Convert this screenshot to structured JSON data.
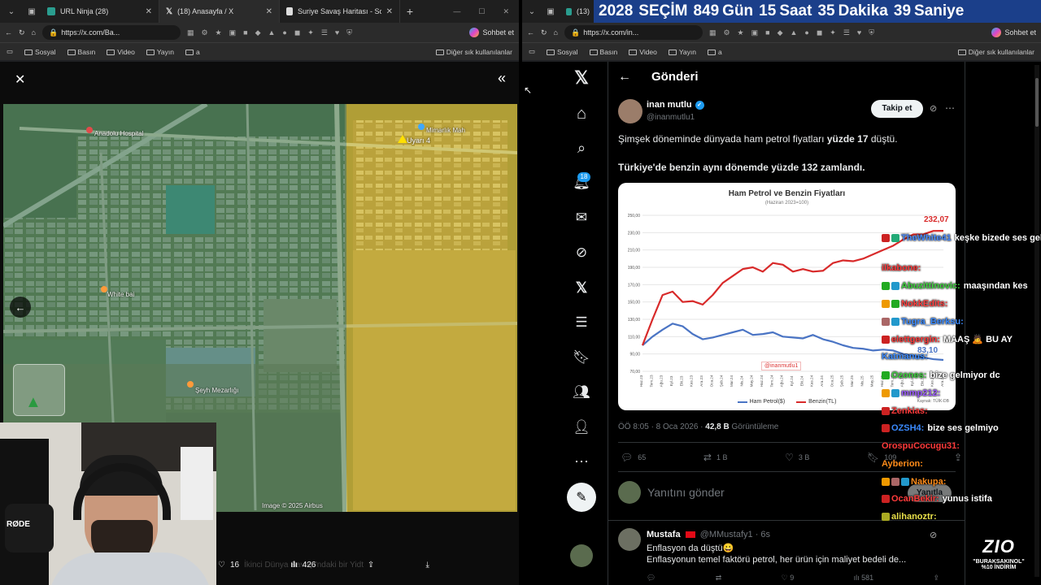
{
  "left_window": {
    "tabs": [
      {
        "label": "URL Ninja (28)"
      },
      {
        "label": "(18) Anasayfa / X"
      },
      {
        "label": "Suriye Savaş Haritası - Son Dak"
      }
    ],
    "url": "https://x.com/Ba...",
    "copilot_label": "Sohbet et",
    "bookmarks": [
      "Sosyal",
      "Basın",
      "Video",
      "Yayın",
      "a"
    ],
    "bookmarks_other": "Diğer sık kullanılanlar",
    "map_labels": {
      "anadolu": "Anadolu Hospital",
      "uyari": "Uyarı 4",
      "mimar": "Mimarlık Mah",
      "white": "White bai",
      "cemetery": "Şeyh Mezarlığı",
      "attribution": "Image © 2025 Airbus"
    },
    "media_stats": {
      "likes": "16",
      "views": "426"
    },
    "faded_text": "İkinci Dünya Savaşı'ndaki bir Yidt"
  },
  "right_window": {
    "tab_label": "(13)",
    "banner": {
      "year": "2028",
      "word": "SEÇİM",
      "days": "849",
      "days_label": "Gün",
      "hours": "15",
      "hours_label": "Saat",
      "minutes": "35",
      "minutes_label": "Dakika",
      "seconds": "39",
      "seconds_label": "Saniye"
    },
    "url": "https://x.com/in...",
    "copilot_label": "Sohbet et",
    "bookmarks": [
      "Sosyal",
      "Basın",
      "Video",
      "Yayın",
      "a"
    ],
    "bookmarks_other": "Diğer sık kullanılanlar",
    "nav_badge": "18",
    "post": {
      "header": "Gönderi",
      "author_name": "inan mutlu",
      "author_handle": "@inanmutlu1",
      "follow_label": "Takip et",
      "text1_pre": "Şimşek döneminde dünyada ham petrol fiyatları ",
      "text1_bold": "yüzde 17",
      "text1_post": " düştü.",
      "text2": "Türkiye'de benzin aynı dönemde yüzde 132 zamlandı.",
      "time": "ÖÖ 8:05 · 8 Oca 2026 · ",
      "views": "42,8 B",
      "views_label": " Görüntüleme",
      "replies": "65",
      "reposts": "1 B",
      "likes": "3 B",
      "bookmarks": "109",
      "reply_placeholder": "Yanıtını gönder",
      "reply_button": "Yanıtla"
    },
    "reply": {
      "name": "Mustafa",
      "handle": "@MMustafy1 · 6s",
      "line1": "Enflasyon da düştü😀",
      "line2": "Enflasyonun temel faktörü petrol, her ürün için maliyet bedeli de...",
      "views": "581",
      "likes": "9"
    }
  },
  "chart_data": {
    "type": "line",
    "title": "Ham Petrol ve Benzin Fiyatları",
    "subtitle": "(Haziran 2023=100)",
    "watermark": "@inanmutlu1",
    "source": "Kaynak: TÜİK-DB",
    "categories": [
      "Haz.23",
      "Tem.23",
      "Ağu.23",
      "Eyl.23",
      "Eki.23",
      "Kas.23",
      "Ara.23",
      "Oca.24",
      "Şub.24",
      "Mar.24",
      "Nis.24",
      "May.24",
      "Haz.24",
      "Tem.24",
      "Ağu.24",
      "Eyl.24",
      "Eki.24",
      "Kas.24",
      "Ara.24",
      "Oca.25",
      "Şub.25",
      "Mar.25",
      "Nis.25",
      "May.25",
      "Haz.25",
      "Tem.25",
      "Ağu.25",
      "Eyl.25",
      "Eki.25",
      "Kas.25",
      "Ara.25"
    ],
    "ylim": [
      70,
      250
    ],
    "yticks": [
      "250,00",
      "230,00",
      "210,00",
      "190,00",
      "170,00",
      "150,00",
      "130,00",
      "110,00",
      "90,00",
      "70,00"
    ],
    "series": [
      {
        "name": "Ham Petrol($)",
        "color": "#4a74c4",
        "values": [
          100,
          110,
          118,
          125,
          122,
          113,
          107,
          109,
          112,
          115,
          118,
          112,
          113,
          115,
          110,
          109,
          108,
          112,
          107,
          104,
          100,
          97,
          96,
          94,
          95,
          94,
          90,
          88,
          86,
          84,
          83.1
        ]
      },
      {
        "name": "Benzin(TL)",
        "color": "#d82a2a",
        "values": [
          100,
          130,
          158,
          162,
          150,
          151,
          147,
          158,
          172,
          180,
          188,
          190,
          185,
          195,
          193,
          185,
          188,
          185,
          186,
          195,
          198,
          197,
          200,
          205,
          210,
          215,
          222,
          228,
          228,
          232,
          232.07
        ]
      }
    ],
    "end_labels": {
      "top": "232,07",
      "bottom": "83,10"
    }
  },
  "chat": [
    {
      "user": "TheWhite41",
      "color": "#4b8bff",
      "msg": "keşke bizede ses gelse",
      "badges": [
        "#c22",
        "#2a7"
      ]
    },
    {
      "user": "ilkabone:",
      "color": "#ff3b3b",
      "msg": "",
      "badges": []
    },
    {
      "user": "Abuzittinovic:",
      "color": "#3fd13f",
      "msg": "maaşından kes",
      "badges": [
        "#2a2",
        "#29c"
      ]
    },
    {
      "user": "NokkEdits:",
      "color": "#ff4040",
      "msg": "",
      "badges": [
        "#e90",
        "#2a2"
      ]
    },
    {
      "user": "Tugra_Berksu:",
      "color": "#3b8bff",
      "msg": "",
      "badges": [
        "#a66",
        "#29c"
      ]
    },
    {
      "user": "elettgergin:",
      "color": "#ff3b3b",
      "msg": "MAAŞ 🙇 BU AY",
      "badges": [
        "#c22"
      ]
    },
    {
      "user": "Katmanus:",
      "color": "#3b8bff",
      "msg": "",
      "badges": []
    },
    {
      "user": "Ozones:",
      "color": "#3fd13f",
      "msg": "bize gelmiyor dc",
      "badges": [
        "#2a2"
      ]
    },
    {
      "user": "mmp212:",
      "color": "#9b59ff",
      "msg": "",
      "badges": [
        "#e90",
        "#29c"
      ]
    },
    {
      "user": "Zenkias:",
      "color": "#ff3b3b",
      "msg": "",
      "badges": [
        "#c22"
      ]
    },
    {
      "user": "OZSH4:",
      "color": "#3b8bff",
      "msg": "bize ses gelmiyo",
      "badges": [
        "#c22"
      ]
    },
    {
      "user": "OrospuCocugu31:",
      "color": "#ff3b3b",
      "msg": "",
      "badges": []
    },
    {
      "user": "Ayberion:",
      "color": "#ff8c1a",
      "msg": "",
      "badges": []
    },
    {
      "user": "Nakupa:",
      "color": "#ff8c1a",
      "msg": "",
      "badges": [
        "#e90",
        "#a66",
        "#29c"
      ]
    },
    {
      "user": "OcanBekir:",
      "color": "#ff3b3b",
      "msg": "yunus istifa",
      "badges": [
        "#c22"
      ]
    },
    {
      "user": "alihanoztr:",
      "color": "#e8e04a",
      "msg": "",
      "badges": [
        "#aa2"
      ]
    }
  ],
  "overlay": {
    "brand": "ZIO",
    "promo": "\"BURAKSAKINOL\"",
    "discount": "%10 İNDİRİM",
    "mic": "RØDE"
  }
}
